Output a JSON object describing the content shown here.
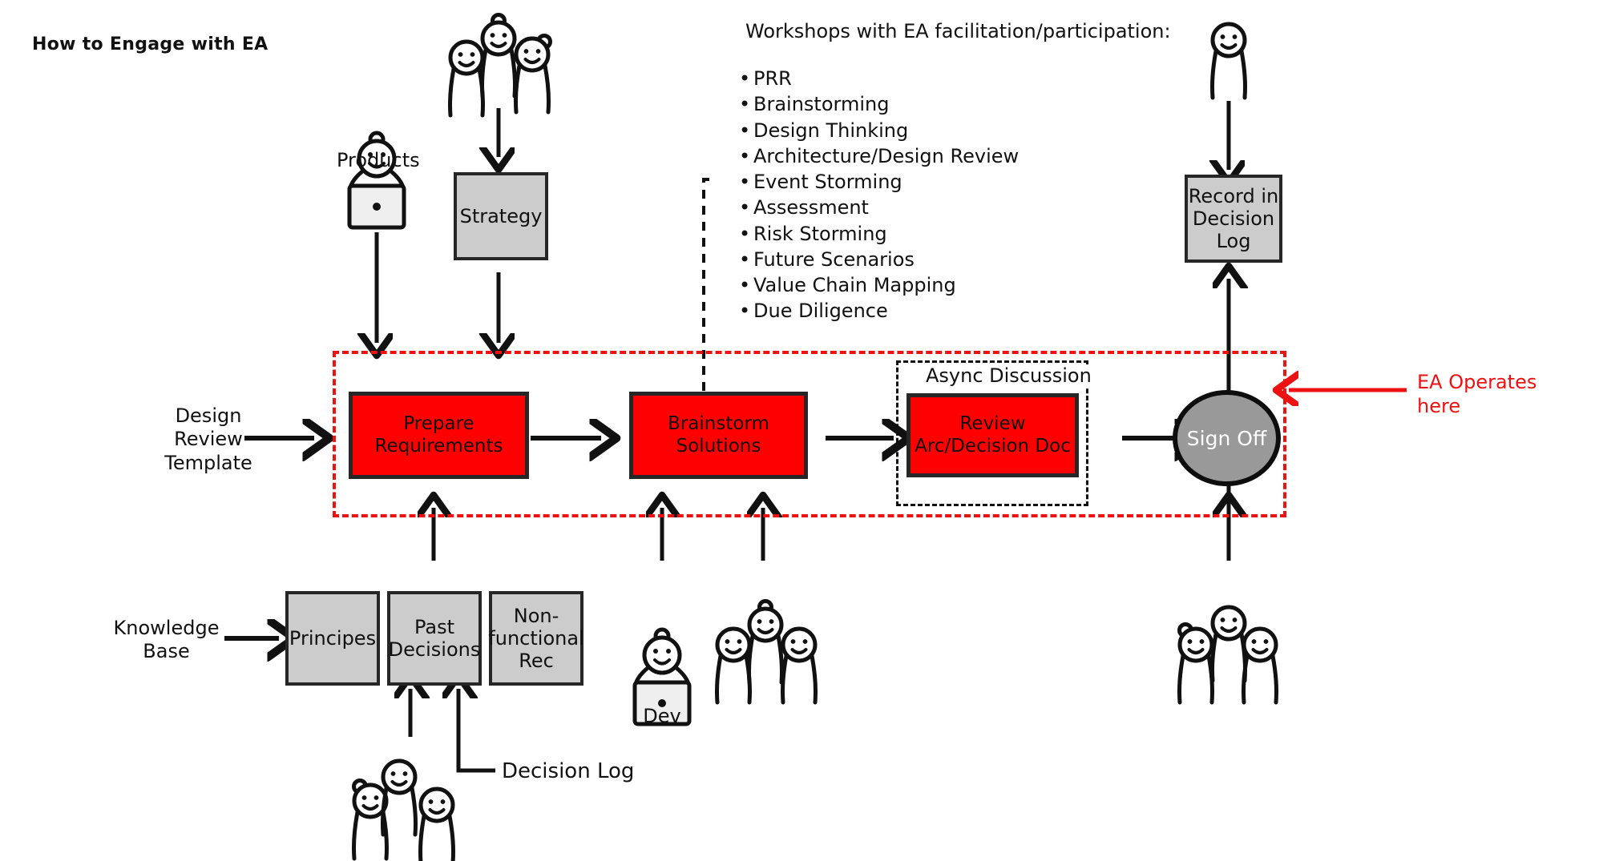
{
  "title": "How to Engage with EA",
  "workshops": {
    "heading": "Workshops with EA facilitation/participation:",
    "items": [
      "PRR",
      "Brainstorming",
      "Design Thinking",
      "Architecture/Design Review",
      "Event Storming",
      "Assessment",
      "Risk Storming",
      "Future Scenarios",
      "Value Chain Mapping",
      "Due Diligence"
    ]
  },
  "labels": {
    "products": "Products",
    "design_review_template": "Design\nReview\nTemplate",
    "knowledge_base": "Knowledge\nBase",
    "dev": "Dev",
    "decision_log": "Decision Log",
    "ea_operates_here": "EA Operates\nhere",
    "async_discussion": "Async Discussion"
  },
  "boxes": {
    "strategy": "Strategy",
    "record_in_decision_log": "Record in\nDecision\nLog",
    "principes": "Principes",
    "past_decisions": "Past\nDecisions",
    "non_functional_rec": "Non-\nfunctional\nRec"
  },
  "process": {
    "prepare_requirements": "Prepare\nRequirements",
    "brainstorm_solutions": "Brainstorm\nSolutions",
    "review_arc_decision_doc": "Review\nArc/Decision Doc",
    "sign_off": "Sign Off"
  },
  "colors": {
    "process_fill": "#FF0000",
    "process_border": "#262626",
    "artifact_fill": "#CCCCCC",
    "signoff_fill": "#999999",
    "boundary": "#EE1111",
    "annotation": "#EE1111",
    "line": "#111111"
  }
}
